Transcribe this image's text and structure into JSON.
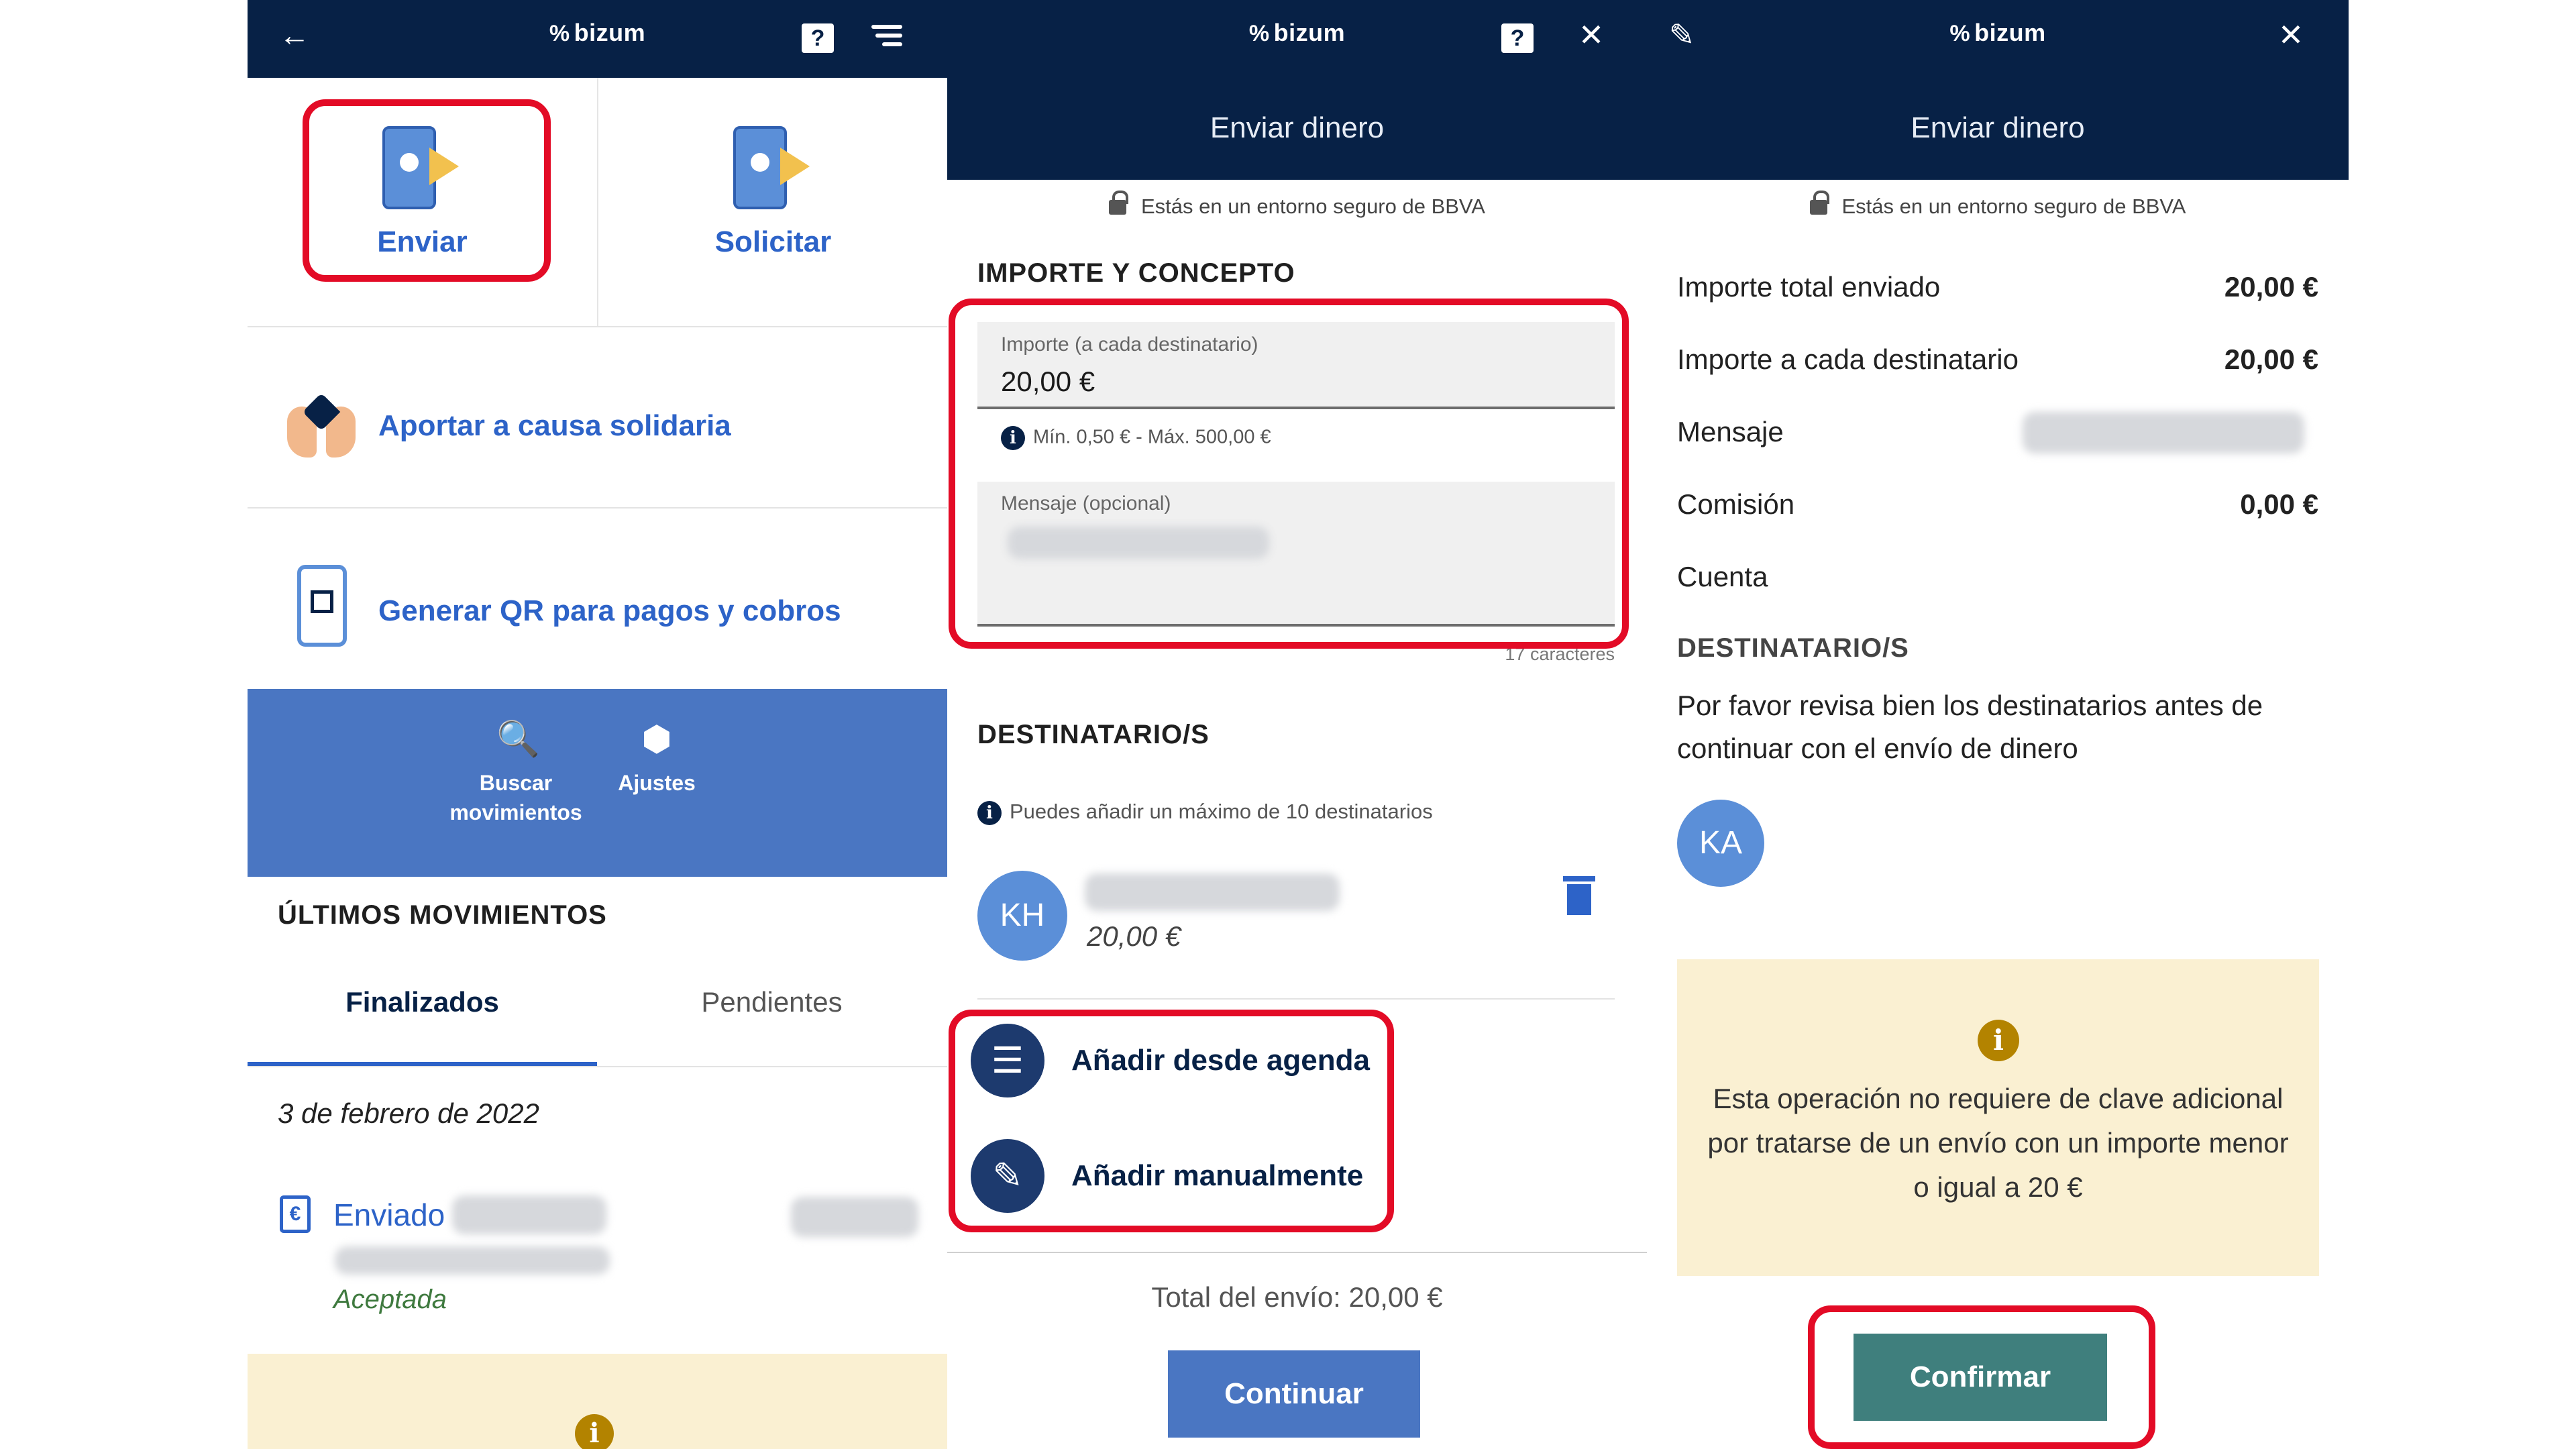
{
  "brand": "bizum",
  "brand_symbol": "%",
  "colors": {
    "navy": "#072146",
    "link_blue": "#2d63c8",
    "bar_blue": "#4a76c2",
    "highlight_red": "#e30b26",
    "confirm_teal": "#3f7f7d",
    "notice_yellow": "#faf0d2"
  },
  "panel1": {
    "icons": {
      "back": "arrow-left-icon",
      "help": "help-icon",
      "menu": "hamburger-icon"
    },
    "tiles": [
      {
        "label": "Enviar"
      },
      {
        "label": "Solicitar"
      }
    ],
    "links": [
      {
        "label": "Aportar a causa solidaria"
      },
      {
        "label": "Generar QR para pagos y cobros"
      }
    ],
    "quick_actions": [
      {
        "line1": "Buscar",
        "line2": "movimientos"
      },
      {
        "label": "Ajustes"
      }
    ],
    "movements_title": "ÚLTIMOS MOVIMIENTOS",
    "tabs": [
      {
        "label": "Finalizados"
      },
      {
        "label": "Pendientes"
      }
    ],
    "date": "3 de febrero de 2022",
    "movement": {
      "label": "Enviado",
      "status": "Aceptada"
    }
  },
  "panel2": {
    "icons": {
      "help": "help-icon",
      "close": "close-icon"
    },
    "title": "Enviar dinero",
    "secure_text": "Estás en un entorno seguro de BBVA",
    "section_amount": "IMPORTE Y CONCEPTO",
    "amount_field": {
      "label": "Importe (a cada destinatario)",
      "value": "20,00 €"
    },
    "limits": "Mín. 0,50 € - Máx. 500,00 €",
    "message_field": {
      "label": "Mensaje (opcional)"
    },
    "char_count": "17 caracteres",
    "section_recipients": "DESTINATARIO/S",
    "recipients_info": "Puedes añadir un máximo de 10 destinatarios",
    "recipient": {
      "initials": "KH",
      "amount": "20,00 €"
    },
    "add_from_agenda": "Añadir desde agenda",
    "add_manually": "Añadir manualmente",
    "total": "Total del envío: 20,00 €",
    "continue": "Continuar"
  },
  "panel3": {
    "icons": {
      "edit": "pencil-icon",
      "close": "close-icon"
    },
    "title": "Enviar dinero",
    "secure_text": "Estás en un entorno seguro de BBVA",
    "rows": [
      {
        "label": "Importe total enviado",
        "value": "20,00 €"
      },
      {
        "label": "Importe a cada destinatario",
        "value": "20,00 €"
      },
      {
        "label": "Mensaje",
        "value": ""
      },
      {
        "label": "Comisión",
        "value": "0,00 €"
      },
      {
        "label": "Cuenta",
        "value": ""
      }
    ],
    "section_recipients": "DESTINATARIO/S",
    "review_text": "Por favor revisa bien los destinatarios antes de continuar con el envío de dinero",
    "recipient_initials": "KA",
    "notice": "Esta operación no requiere de clave adicional por tratarse de un envío con un importe menor o igual a 20 €",
    "confirm": "Confirmar"
  }
}
